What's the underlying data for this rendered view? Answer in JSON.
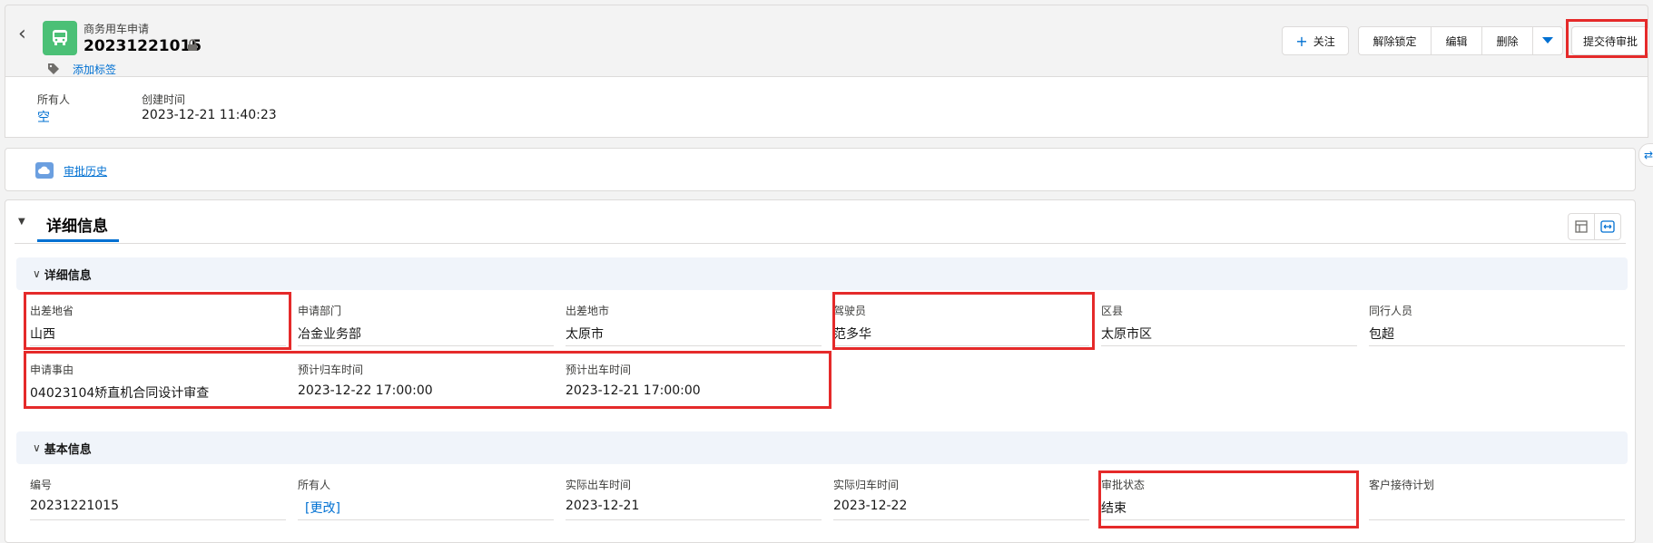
{
  "header": {
    "object_type": "商务用车申请",
    "record_title": "20231221015",
    "add_tag": "添加标签",
    "buttons": {
      "follow": "关注",
      "unlock": "解除锁定",
      "edit": "编辑",
      "delete": "删除",
      "submit": "提交待审批"
    }
  },
  "highlights": [
    {
      "label": "所有人",
      "value": "空"
    },
    {
      "label": "创建时间",
      "value": "2023-12-21 11:40:23"
    }
  ],
  "approval": {
    "link": "审批历史"
  },
  "details": {
    "tab_title": "详细信息",
    "section1": {
      "title": "详细信息",
      "fields": [
        {
          "label": "出差地省",
          "value": "山西"
        },
        {
          "label": "申请部门",
          "value": "冶金业务部"
        },
        {
          "label": "出差地市",
          "value": "太原市"
        },
        {
          "label": "驾驶员",
          "value": "范多华"
        },
        {
          "label": "区县",
          "value": "太原市区"
        },
        {
          "label": "同行人员",
          "value": "包超"
        },
        {
          "label": "申请事由",
          "value": "04023104矫直机合同设计审查"
        },
        {
          "label": "预计归车时间",
          "value": "2023-12-22 17:00:00"
        },
        {
          "label": "预计出车时间",
          "value": "2023-12-21 17:00:00"
        }
      ]
    },
    "section2": {
      "title": "基本信息",
      "fields": [
        {
          "label": "编号",
          "value": "20231221015"
        },
        {
          "label": "所有人",
          "value": "[更改]"
        },
        {
          "label": "实际出车时间",
          "value": "2023-12-21"
        },
        {
          "label": "实际归车时间",
          "value": "2023-12-22"
        },
        {
          "label": "审批状态",
          "value": "结束"
        },
        {
          "label": "客户接待计划",
          "value": ""
        }
      ]
    }
  },
  "colors": {
    "accent": "#0070d2",
    "highlight_box": "#e52a2a",
    "app_icon": "#4bc076"
  }
}
